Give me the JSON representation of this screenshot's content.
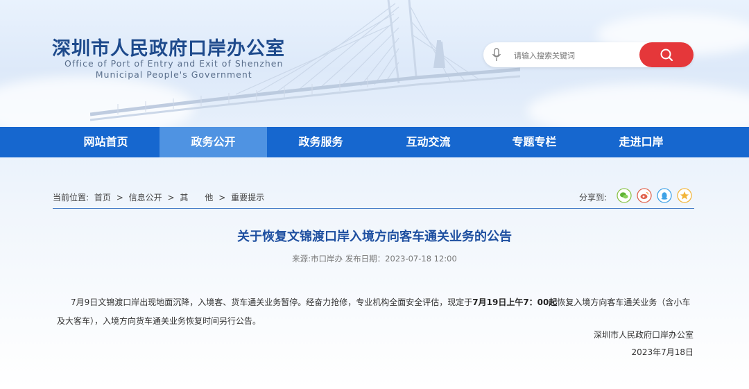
{
  "header": {
    "org_name_cn": "深圳市人民政府口岸办公室",
    "org_name_en_line1": "Office of Port of Entry and Exit of Shenzhen",
    "org_name_en_line2": "Municipal People's Government"
  },
  "search": {
    "placeholder": "请输入搜索关键词",
    "mic_icon": "microphone-icon",
    "button_icon": "search-icon"
  },
  "nav": {
    "items": [
      {
        "label": "网站首页"
      },
      {
        "label": "政务公开",
        "active": true
      },
      {
        "label": "政务服务"
      },
      {
        "label": "互动交流"
      },
      {
        "label": "专题专栏"
      },
      {
        "label": "走进口岸"
      }
    ]
  },
  "breadcrumb": {
    "prefix": "当前位置:",
    "items": [
      "首页",
      "信息公开",
      "其　　他",
      "重要提示"
    ],
    "separator": ">"
  },
  "share": {
    "label": "分享到:",
    "icons": [
      "wechat-icon",
      "weibo-icon",
      "qq-icon",
      "qzone-icon"
    ]
  },
  "article": {
    "title": "关于恢复文锦渡口岸入境方向客车通关业务的公告",
    "meta": "来源:市口岸办 发布日期：2023-07-18 12:00",
    "body_part1": "7月9日文锦渡口岸出现地面沉降，入境客、货车通关业务暂停。经奋力抢修，专业机构全面安全评估，现定于",
    "body_bold": "7月19日上午7：00起",
    "body_part2": "恢复入境方向客车通关业务（含小车及大客车），入境方向货车通关业务恢复时间另行公告。",
    "signature": "深圳市人民政府口岸办公室",
    "date": "2023年7月18日"
  },
  "colors": {
    "nav_bg": "#1667cf",
    "nav_active": "#4f93e2",
    "title": "#1e4fa0",
    "search_button": "#e5373a"
  }
}
